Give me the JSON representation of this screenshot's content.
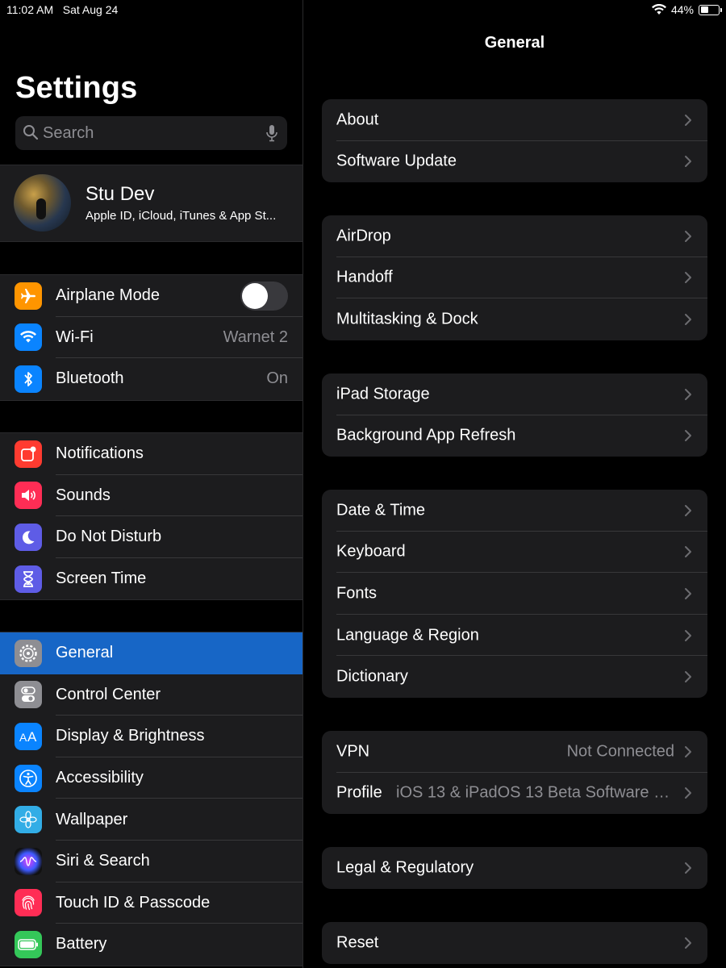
{
  "status_bar": {
    "time": "11:02 AM",
    "date": "Sat Aug 24",
    "battery_percent_text": "44%",
    "battery_level": 0.44,
    "wifi_icon": "wifi-icon"
  },
  "sidebar": {
    "title": "Settings",
    "search": {
      "placeholder": "Search"
    },
    "profile": {
      "name": "Stu Dev",
      "subtitle": "Apple ID, iCloud, iTunes & App St..."
    },
    "groups": [
      {
        "items": [
          {
            "label": "Airplane Mode",
            "icon": "airplane-icon",
            "icon_color": "#ff9500",
            "toggle": false
          },
          {
            "label": "Wi-Fi",
            "icon": "wifi-icon",
            "icon_color": "#0a84ff",
            "value": "Warnet 2"
          },
          {
            "label": "Bluetooth",
            "icon": "bluetooth-icon",
            "icon_color": "#0a84ff",
            "value": "On"
          }
        ]
      },
      {
        "items": [
          {
            "label": "Notifications",
            "icon": "notifications-icon",
            "icon_color": "#ff3b30"
          },
          {
            "label": "Sounds",
            "icon": "speaker-icon",
            "icon_color": "#ff2d55"
          },
          {
            "label": "Do Not Disturb",
            "icon": "moon-icon",
            "icon_color": "#5e5ce6"
          },
          {
            "label": "Screen Time",
            "icon": "hourglass-icon",
            "icon_color": "#5e5ce6"
          }
        ]
      },
      {
        "items": [
          {
            "label": "General",
            "icon": "gear-icon",
            "icon_color": "#8e8e93",
            "selected": true
          },
          {
            "label": "Control Center",
            "icon": "switches-icon",
            "icon_color": "#8e8e93"
          },
          {
            "label": "Display & Brightness",
            "icon": "text-size-icon",
            "icon_color": "#0a84ff"
          },
          {
            "label": "Accessibility",
            "icon": "accessibility-icon",
            "icon_color": "#0a84ff"
          },
          {
            "label": "Wallpaper",
            "icon": "flower-icon",
            "icon_color": "#32ade6"
          },
          {
            "label": "Siri & Search",
            "icon": "siri-icon",
            "icon_color": "#1c1c1e"
          },
          {
            "label": "Touch ID & Passcode",
            "icon": "fingerprint-icon",
            "icon_color": "#ff2d55"
          },
          {
            "label": "Battery",
            "icon": "battery-icon",
            "icon_color": "#34c759"
          }
        ]
      }
    ]
  },
  "detail": {
    "title": "General",
    "cards": [
      {
        "rows": [
          {
            "label": "About"
          },
          {
            "label": "Software Update"
          }
        ]
      },
      {
        "rows": [
          {
            "label": "AirDrop"
          },
          {
            "label": "Handoff"
          },
          {
            "label": "Multitasking & Dock"
          }
        ]
      },
      {
        "rows": [
          {
            "label": "iPad Storage"
          },
          {
            "label": "Background App Refresh"
          }
        ]
      },
      {
        "rows": [
          {
            "label": "Date & Time"
          },
          {
            "label": "Keyboard"
          },
          {
            "label": "Fonts"
          },
          {
            "label": "Language & Region"
          },
          {
            "label": "Dictionary"
          }
        ]
      },
      {
        "rows": [
          {
            "label": "VPN",
            "value": "Not Connected"
          },
          {
            "label": "Profile",
            "value": "iOS 13 & iPadOS 13 Beta Software Pr..."
          }
        ]
      },
      {
        "rows": [
          {
            "label": "Legal & Regulatory"
          }
        ]
      },
      {
        "rows": [
          {
            "label": "Reset"
          }
        ]
      }
    ]
  },
  "colors": {
    "selected_row": "#1766c6",
    "cell_bg": "#1c1c1e",
    "secondary_text": "#8e8e93"
  }
}
